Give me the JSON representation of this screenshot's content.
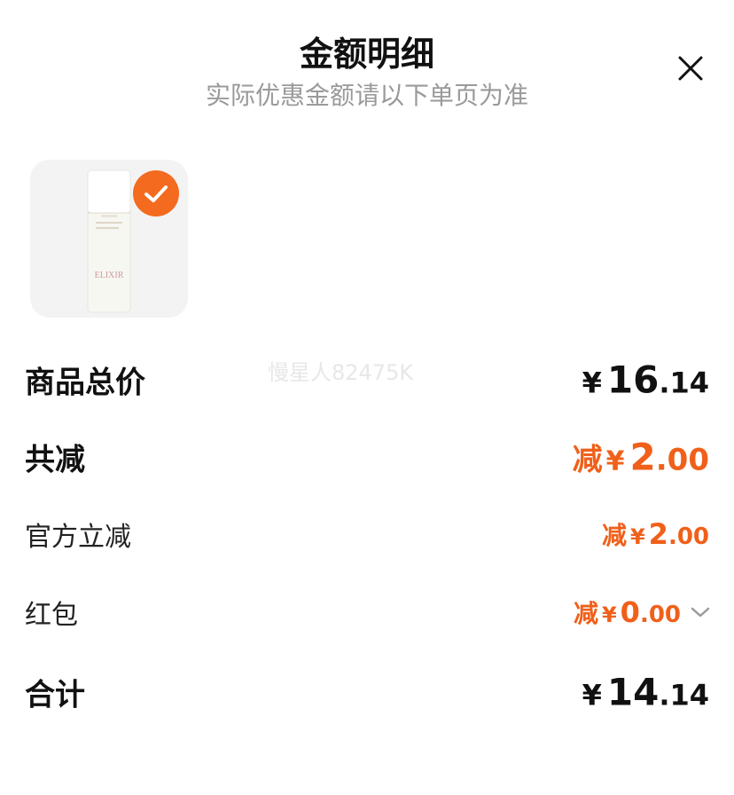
{
  "header": {
    "title": "金额明细",
    "subtitle": "实际优惠金额请以下单页为准",
    "close_icon": "close-icon"
  },
  "product": {
    "image_icon": "product-bottle-icon",
    "brand_text": "ELIXIR",
    "selected": true,
    "check_icon": "check-icon"
  },
  "watermark": "慢星人82475K",
  "rows": {
    "total_price": {
      "label": "商品总价",
      "yen": "¥",
      "int": "16",
      "dec": ".14"
    },
    "total_reduce": {
      "label": "共减",
      "prefix": "减",
      "yen": "¥",
      "int": "2",
      "dec": ".00"
    },
    "official_reduce": {
      "label": "官方立减",
      "prefix": "减",
      "yen": "¥",
      "int": "2",
      "dec": ".00"
    },
    "red_packet": {
      "label": "红包",
      "prefix": "减",
      "yen": "¥",
      "int": "0",
      "dec": ".00",
      "chevron_icon": "chevron-down-icon"
    },
    "sum": {
      "label": "合计",
      "yen": "¥",
      "int": "14",
      "dec": ".14"
    }
  },
  "colors": {
    "accent": "#f0601a",
    "check_bg": "#f46a1e",
    "subtitle": "#9a9a9a"
  }
}
